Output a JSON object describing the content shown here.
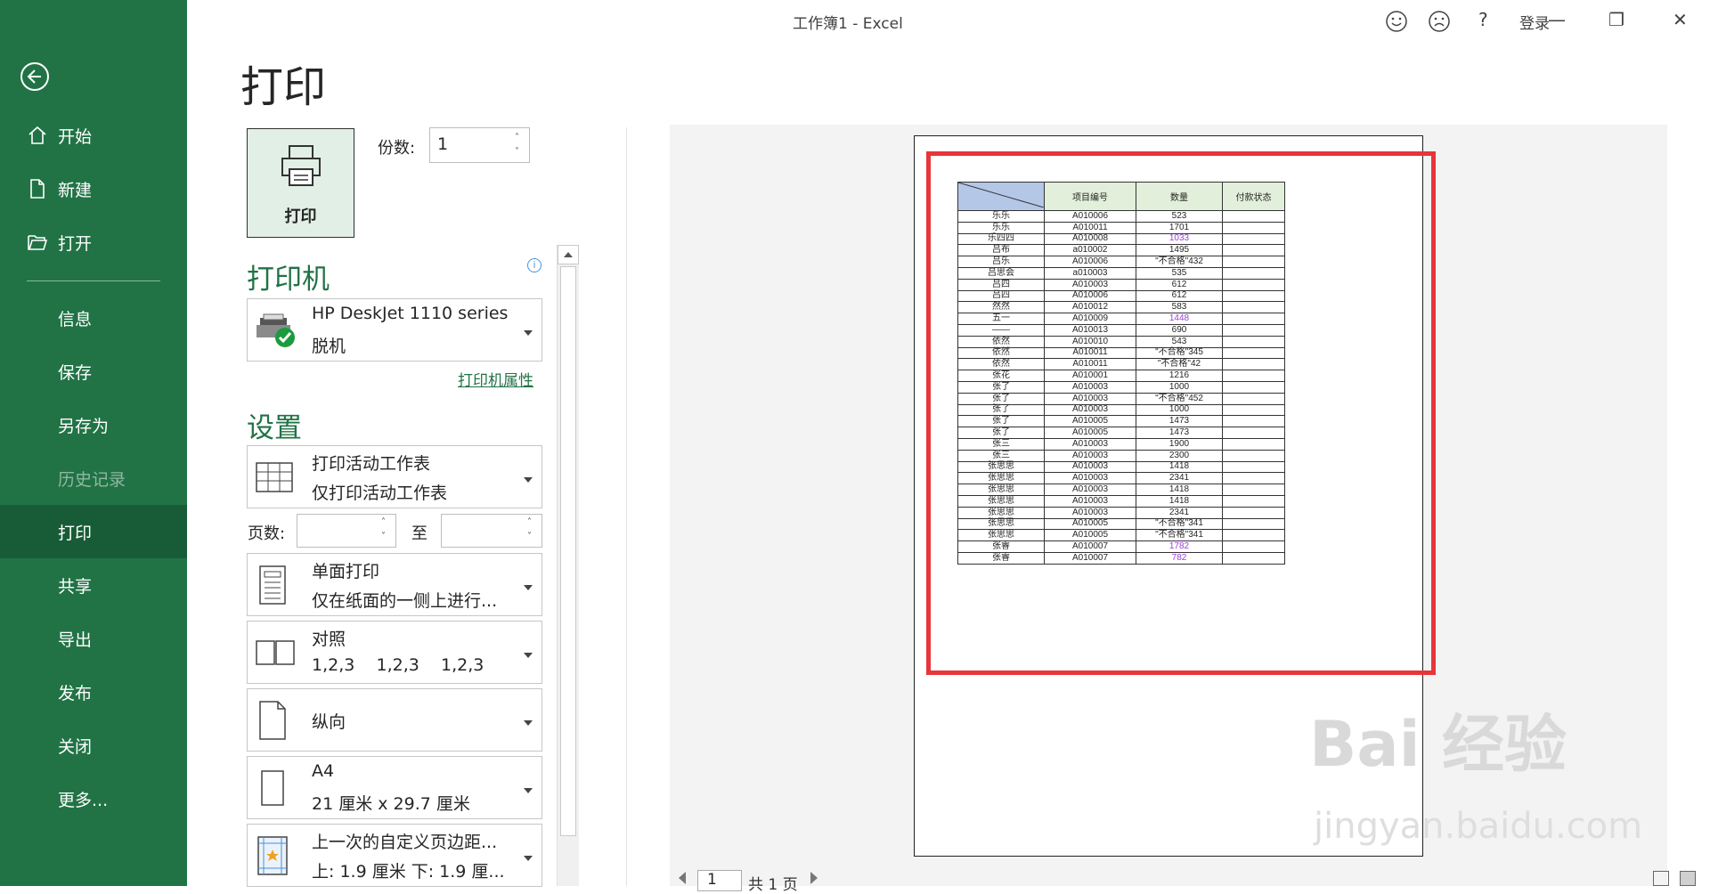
{
  "window": {
    "title": "工作簿1  -  Excel",
    "signin": "登录",
    "help": "?",
    "minimize": "—",
    "restore": "❐",
    "close": "✕"
  },
  "sidebar": {
    "back": "back",
    "items": [
      {
        "label": "开始"
      },
      {
        "label": "新建"
      },
      {
        "label": "打开"
      },
      {
        "label": "信息"
      },
      {
        "label": "保存"
      },
      {
        "label": "另存为"
      },
      {
        "label": "历史记录"
      },
      {
        "label": "打印"
      },
      {
        "label": "共享"
      },
      {
        "label": "导出"
      },
      {
        "label": "发布"
      },
      {
        "label": "关闭"
      },
      {
        "label": "更多..."
      }
    ]
  },
  "print": {
    "title": "打印",
    "button": "打印",
    "copies_label": "份数:",
    "copies_value": "1",
    "printer_heading": "打印机",
    "printer_name": "HP DeskJet 1110 series",
    "printer_status": "脱机",
    "printer_props": "打印机属性",
    "settings_heading": "设置",
    "settings": [
      {
        "l1": "打印活动工作表",
        "l2": "仅打印活动工作表"
      },
      {
        "l1": "单面打印",
        "l2": "仅在纸面的一侧上进行..."
      },
      {
        "l1": "对照",
        "l2": "1,2,3    1,2,3    1,2,3"
      },
      {
        "l1": "纵向",
        "l2": ""
      },
      {
        "l1": "A4",
        "l2": "21 厘米 x 29.7 厘米"
      },
      {
        "l1": "上一次的自定义页边距...",
        "l2": "上: 1.9 厘米 下: 1.9 厘..."
      }
    ],
    "pages_label": "页数:",
    "to_label": "至"
  },
  "preview": {
    "headers": [
      "",
      "项目编号",
      "数量",
      "付款状态"
    ],
    "rows": [
      [
        "乐乐",
        "A010006",
        "523",
        ""
      ],
      [
        "乐乐",
        "A010011",
        "1701",
        ""
      ],
      [
        "乐四四",
        "A010008",
        "1033",
        ""
      ],
      [
        "吕布",
        "a010002",
        "1495",
        ""
      ],
      [
        "吕乐",
        "A010006",
        "\"不合格\"432",
        ""
      ],
      [
        "吕思会",
        "a010003",
        "535",
        ""
      ],
      [
        "吕四",
        "A010003",
        "612",
        ""
      ],
      [
        "吕四",
        "A010006",
        "612",
        ""
      ],
      [
        "然然",
        "A010012",
        "583",
        ""
      ],
      [
        "五一",
        "A010009",
        "1448",
        ""
      ],
      [
        "——",
        "A010013",
        "690",
        ""
      ],
      [
        "依然",
        "A010010",
        "543",
        ""
      ],
      [
        "依然",
        "A010011",
        "\"不合格\"345",
        ""
      ],
      [
        "依然",
        "A010011",
        "\"不合格\"42",
        ""
      ],
      [
        "张花",
        "A010001",
        "1216",
        ""
      ],
      [
        "张了",
        "A010003",
        "1000",
        ""
      ],
      [
        "张了",
        "A010003",
        "\"不合格\"452",
        ""
      ],
      [
        "张了",
        "A010003",
        "1000",
        ""
      ],
      [
        "张了",
        "A010005",
        "1473",
        ""
      ],
      [
        "张了",
        "A010005",
        "1473",
        ""
      ],
      [
        "张三",
        "A010003",
        "1900",
        ""
      ],
      [
        "张三",
        "A010003",
        "2300",
        ""
      ],
      [
        "张思思",
        "A010003",
        "1418",
        ""
      ],
      [
        "张思思",
        "A010003",
        "2341",
        ""
      ],
      [
        "张思思",
        "A010003",
        "1418",
        ""
      ],
      [
        "张思思",
        "A010003",
        "1418",
        ""
      ],
      [
        "张思思",
        "A010003",
        "2341",
        ""
      ],
      [
        "张思思",
        "A010005",
        "\"不合格\"341",
        ""
      ],
      [
        "张思思",
        "A010005",
        "\"不合格\"341",
        ""
      ],
      [
        "张睿",
        "A010007",
        "1782",
        ""
      ],
      [
        "张睿",
        "A010007",
        "782",
        ""
      ]
    ],
    "purple_rows": [
      2,
      9,
      29,
      30
    ],
    "pager_value": "1",
    "pager_text": "共 1 页"
  },
  "watermark": {
    "brand": "Bai 经验",
    "url": "jingyan.baidu.com"
  },
  "colors": {
    "sidebar": "#217346",
    "active": "#185c37",
    "accent": "#217346",
    "highlight": "#e8353a"
  }
}
